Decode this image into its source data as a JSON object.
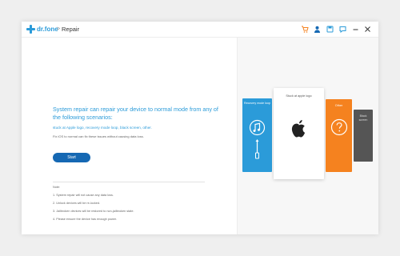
{
  "app": {
    "brand": "dr.fone",
    "separator": ">",
    "crumb": "Repair"
  },
  "toolbar_icons": [
    "cart-icon",
    "account-icon",
    "save-icon",
    "feedback-icon",
    "minimize-icon",
    "close-icon"
  ],
  "colors": {
    "accent": "#2b9bd9",
    "start_button": "#1568b3",
    "cart": "#f5821f",
    "card_blue": "#2b9bd9",
    "card_orange": "#f5821f",
    "card_dark": "#555555"
  },
  "main": {
    "headline": "System repair can repair your device to normal mode from any of the following scenarios:",
    "scenarios": "stuck at Apple logo, recovery mode loop, black screen, other.",
    "fix_note": "Fix iOS to normal can fix these issues without causing data loss.",
    "start_label": "Start"
  },
  "notes": {
    "title": "Note:",
    "items": [
      "1. System repair will not cause any data loss.",
      "2. Unlock devices will be re-locked.",
      "3. Jailbroken devices will be restored to non-jailbroken state.",
      "4. Please ensure the device has enough power."
    ]
  },
  "cards": [
    {
      "label": "Recovery mode loop",
      "icon": "itunes-usb-icon"
    },
    {
      "label": "Stuck at apple logo",
      "icon": "apple-logo-icon"
    },
    {
      "label": "Other",
      "icon": "question-icon"
    },
    {
      "label": "Black screen",
      "icon": ""
    }
  ]
}
